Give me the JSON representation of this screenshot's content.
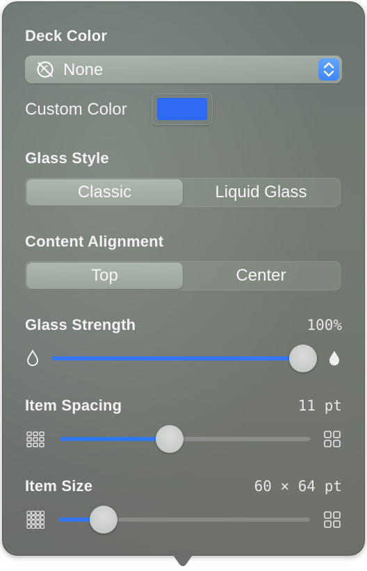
{
  "deck_color": {
    "label": "Deck Color",
    "selected": "None",
    "icon": "no-color-icon"
  },
  "custom_color": {
    "label": "Custom Color",
    "color": "#2f6bf2"
  },
  "glass_style": {
    "label": "Glass Style",
    "options": [
      "Classic",
      "Liquid Glass"
    ],
    "selected": "Classic"
  },
  "content_alignment": {
    "label": "Content Alignment",
    "options": [
      "Top",
      "Center"
    ],
    "selected": "Top"
  },
  "glass_strength": {
    "label": "Glass Strength",
    "value_text": "100%",
    "level": 1.0,
    "min_icon": "drop-outline-icon",
    "max_icon": "drop-filled-icon"
  },
  "item_spacing": {
    "label": "Item Spacing",
    "value_text": "11 pt",
    "level": 0.44,
    "min_icon": "grid-tight-icon",
    "max_icon": "grid-wide-icon"
  },
  "item_size": {
    "label": "Item Size",
    "value_text": "60 × 64 pt",
    "level": 0.18,
    "min_icon": "grid-small-icon",
    "max_icon": "grid-large-icon"
  },
  "colors": {
    "accent": "#3476f0",
    "swatch": "#2f6bf2"
  }
}
